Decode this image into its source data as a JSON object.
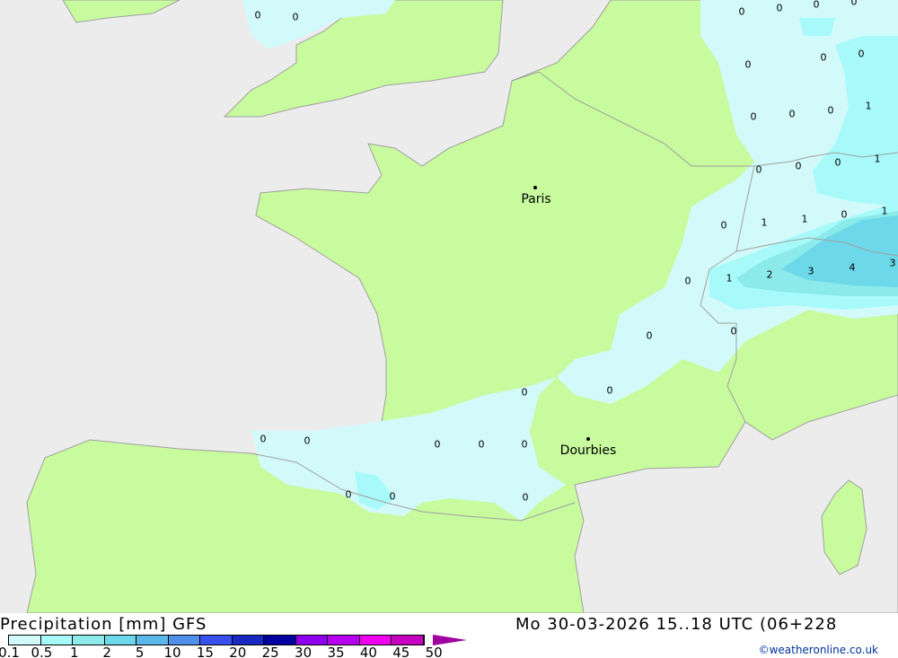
{
  "map": {
    "colors": {
      "sea": "#ececec",
      "land": "#c8fa9e",
      "p01": "#d2fafa",
      "p05": "#a8fafa",
      "p1": "#8ceaea",
      "p2": "#6cd8ea",
      "border": "#a0a0a0"
    },
    "cities": [
      {
        "name": "Paris"
      },
      {
        "name": "Dourbies"
      }
    ],
    "values": [
      "0",
      "0",
      "0",
      "0",
      "0",
      "0",
      "0",
      "0",
      "0",
      "0",
      "0",
      "0",
      "1",
      "0",
      "0",
      "0",
      "1",
      "0",
      "1",
      "1",
      "0",
      "1",
      "0",
      "1",
      "2",
      "3",
      "4",
      "3",
      "0",
      "0",
      "0",
      "0",
      "0",
      "0",
      "0",
      "0",
      "0",
      "0",
      "0",
      "0"
    ]
  },
  "footer": {
    "title": "Precipitation [mm] GFS",
    "datetime": "Mo 30-03-2026 15..18 UTC (06+228",
    "copyright": "©weatheronline.co.uk",
    "legend": {
      "ticks": [
        "0.1",
        "0.5",
        "1",
        "2",
        "5",
        "10",
        "15",
        "20",
        "25",
        "30",
        "35",
        "40",
        "45",
        "50"
      ],
      "colors": [
        "#d2fafa",
        "#a8fafa",
        "#8ceaea",
        "#6cd8ea",
        "#5ab8ea",
        "#5090ea",
        "#3850f0",
        "#1828c0",
        "#0000a0",
        "#9000f0",
        "#b800f0",
        "#f000f0",
        "#c800c0"
      ]
    }
  }
}
